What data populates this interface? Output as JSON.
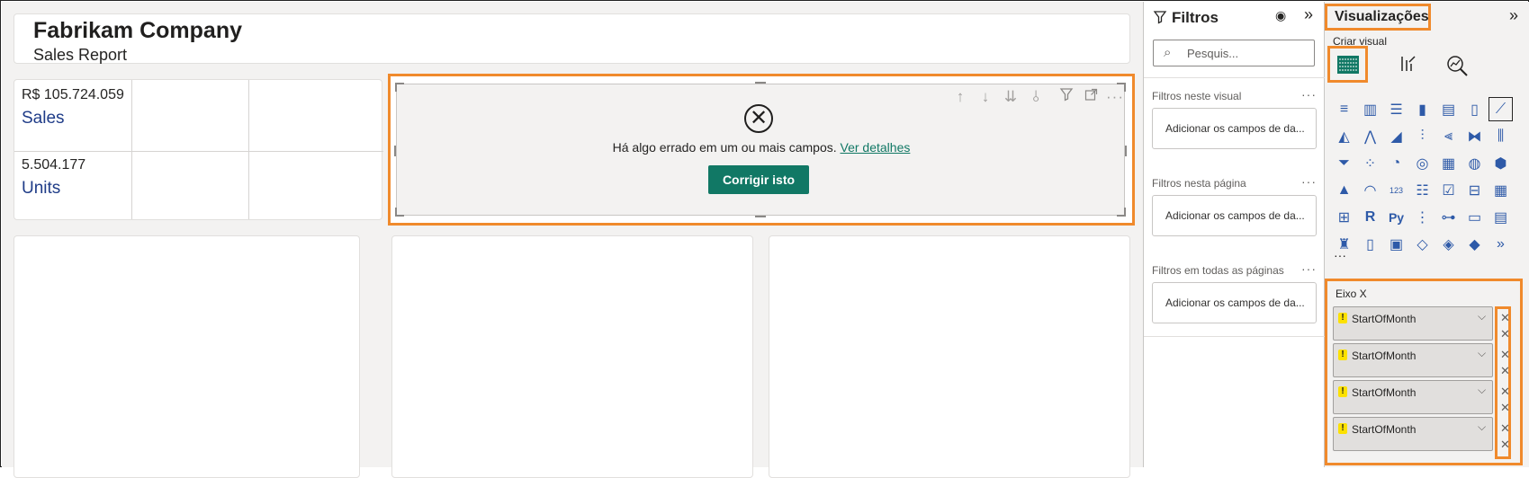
{
  "report": {
    "title": "Fabrikam Company",
    "subtitle": "Sales Report"
  },
  "kpis": [
    {
      "value": "R$ 105.724.059",
      "label": "Sales"
    },
    {
      "value": "5.504.177",
      "label": "Units"
    }
  ],
  "error_visual": {
    "message": "Há algo errado em um ou mais campos.",
    "details_link": "Ver detalhes",
    "fix_button": "Corrigir isto",
    "icons": [
      "arrow-up-icon",
      "arrow-down-icon",
      "double-arrow-down-icon",
      "expand-hierarchy-icon",
      "filter-icon",
      "focus-mode-icon",
      "more-options-icon"
    ]
  },
  "filters_pane": {
    "title": "Filtros",
    "search_placeholder": "Pesquis...",
    "sections": [
      {
        "label": "Filtros neste visual",
        "well": "Adicionar os campos de da..."
      },
      {
        "label": "Filtros nesta página",
        "well": "Adicionar os campos de da..."
      },
      {
        "label": "Filtros em todas as páginas",
        "well": "Adicionar os campos de da..."
      }
    ]
  },
  "viz_pane": {
    "title": "Visualizações",
    "subtitle": "Criar visual",
    "axis_label": "Eixo X",
    "fields": [
      "StartOfMonth",
      "StartOfMonth",
      "StartOfMonth",
      "StartOfMonth"
    ],
    "more": "···"
  },
  "colors": {
    "accent": "#f08a2c",
    "fix_button": "#117865",
    "kpi_label": "#1f3c88"
  }
}
